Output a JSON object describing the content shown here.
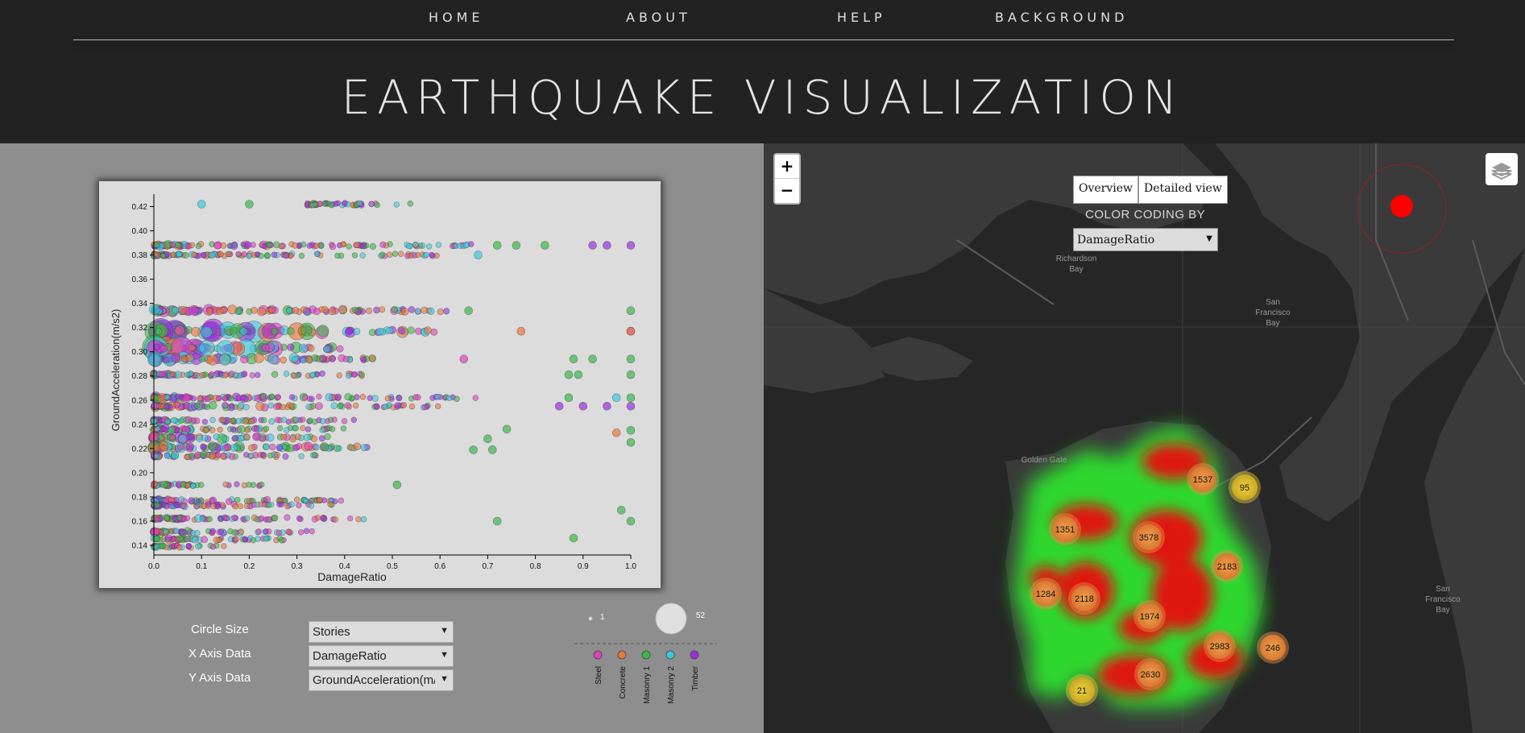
{
  "nav": {
    "home": "HOME",
    "about": "ABOUT",
    "help": "HELP",
    "background": "BACKGROUND"
  },
  "title": "EARTHQUAKE VISUALIZATION",
  "controls": {
    "circle_size_label": "Circle Size",
    "x_axis_label": "X Axis Data",
    "y_axis_label": "Y Axis Data",
    "circle_size_value": "Stories",
    "x_axis_value": "DamageRatio",
    "y_axis_value": "GroundAcceleration(m/s2)"
  },
  "size_legend": {
    "min": "1",
    "max": "52"
  },
  "type_legend": [
    {
      "name": "Steel",
      "color": "#e040c0"
    },
    {
      "name": "Concrete",
      "color": "#e8783a"
    },
    {
      "name": "Masonry 1",
      "color": "#3cb84a"
    },
    {
      "name": "Masonry 2",
      "color": "#3cc8e0"
    },
    {
      "name": "Timber",
      "color": "#9b30e0"
    }
  ],
  "chart_data": {
    "type": "scatter",
    "xlabel": "DamageRatio",
    "ylabel": "GroundAcceleration(m/s2)",
    "xlim": [
      0,
      1.0
    ],
    "ylim": [
      0.134,
      0.425
    ],
    "xticks": [
      "0.0",
      "0.1",
      "0.2",
      "0.3",
      "0.4",
      "0.5",
      "0.6",
      "0.7",
      "0.8",
      "0.9",
      "1.0"
    ],
    "yticks": [
      "0.14",
      "0.16",
      "0.18",
      "0.20",
      "0.22",
      "0.24",
      "0.26",
      "0.28",
      "0.30",
      "0.32",
      "0.34",
      "0.36",
      "0.38",
      "0.40",
      "0.42"
    ],
    "grid": false,
    "bands": [
      {
        "y": 0.422,
        "x": [
          0.32,
          0.55
        ],
        "sizes": [
          1,
          2
        ]
      },
      {
        "y": 0.388,
        "x": [
          0.0,
          0.68
        ],
        "sizes": [
          2,
          6
        ]
      },
      {
        "y": 0.38,
        "x": [
          0.0,
          0.62
        ],
        "sizes": [
          2,
          4
        ]
      },
      {
        "y": 0.334,
        "x": [
          0.0,
          0.62
        ],
        "sizes": [
          3,
          10
        ]
      },
      {
        "y": 0.317,
        "x": [
          0.0,
          0.6
        ],
        "sizes": [
          4,
          30
        ]
      },
      {
        "y": 0.303,
        "x": [
          0.0,
          0.4
        ],
        "sizes": [
          4,
          30
        ]
      },
      {
        "y": 0.294,
        "x": [
          0.0,
          0.48
        ],
        "sizes": [
          3,
          12
        ]
      },
      {
        "y": 0.281,
        "x": [
          0.0,
          0.46
        ],
        "sizes": [
          2,
          5
        ]
      },
      {
        "y": 0.262,
        "x": [
          0.0,
          0.68
        ],
        "sizes": [
          2,
          8
        ]
      },
      {
        "y": 0.255,
        "x": [
          0.0,
          0.6
        ],
        "sizes": [
          2,
          8
        ]
      },
      {
        "y": 0.243,
        "x": [
          0.0,
          0.42
        ],
        "sizes": [
          2,
          5
        ]
      },
      {
        "y": 0.236,
        "x": [
          0.0,
          0.4
        ],
        "sizes": [
          2,
          8
        ]
      },
      {
        "y": 0.229,
        "x": [
          0.0,
          0.38
        ],
        "sizes": [
          3,
          10
        ]
      },
      {
        "y": 0.221,
        "x": [
          0.0,
          0.48
        ],
        "sizes": [
          3,
          12
        ]
      },
      {
        "y": 0.214,
        "x": [
          0.0,
          0.35
        ],
        "sizes": [
          2,
          6
        ]
      },
      {
        "y": 0.19,
        "x": [
          0.0,
          0.23
        ],
        "sizes": [
          2,
          5
        ]
      },
      {
        "y": 0.177,
        "x": [
          0.0,
          0.4
        ],
        "sizes": [
          2,
          6
        ]
      },
      {
        "y": 0.173,
        "x": [
          0.0,
          0.38
        ],
        "sizes": [
          2,
          5
        ]
      },
      {
        "y": 0.162,
        "x": [
          0.0,
          0.45
        ],
        "sizes": [
          2,
          6
        ]
      },
      {
        "y": 0.151,
        "x": [
          0.0,
          0.35
        ],
        "sizes": [
          2,
          6
        ]
      },
      {
        "y": 0.145,
        "x": [
          0.0,
          0.28
        ],
        "sizes": [
          2,
          5
        ]
      },
      {
        "y": 0.139,
        "x": [
          0.0,
          0.15
        ],
        "sizes": [
          2,
          4
        ]
      }
    ],
    "outliers": [
      {
        "x": 0.1,
        "y": 0.422,
        "t": 3
      },
      {
        "x": 0.2,
        "y": 0.422,
        "t": 2
      },
      {
        "x": 0.72,
        "y": 0.388,
        "t": 2
      },
      {
        "x": 0.76,
        "y": 0.388,
        "t": 2
      },
      {
        "x": 0.82,
        "y": 0.388,
        "t": 2
      },
      {
        "x": 0.92,
        "y": 0.388,
        "t": 4
      },
      {
        "x": 0.95,
        "y": 0.388,
        "t": 4
      },
      {
        "x": 1.0,
        "y": 0.388,
        "t": 4
      },
      {
        "x": 0.68,
        "y": 0.38,
        "t": 3
      },
      {
        "x": 0.66,
        "y": 0.334,
        "t": 2
      },
      {
        "x": 1.0,
        "y": 0.334,
        "t": 2
      },
      {
        "x": 0.77,
        "y": 0.317,
        "t": 1
      },
      {
        "x": 1.0,
        "y": 0.317,
        "t": 0
      },
      {
        "x": 1.0,
        "y": 0.317,
        "t": 1
      },
      {
        "x": 0.65,
        "y": 0.294,
        "t": 0
      },
      {
        "x": 0.88,
        "y": 0.294,
        "t": 2
      },
      {
        "x": 0.92,
        "y": 0.294,
        "t": 2
      },
      {
        "x": 1.0,
        "y": 0.294,
        "t": 2
      },
      {
        "x": 0.87,
        "y": 0.281,
        "t": 2
      },
      {
        "x": 0.89,
        "y": 0.281,
        "t": 2
      },
      {
        "x": 1.0,
        "y": 0.281,
        "t": 2
      },
      {
        "x": 0.87,
        "y": 0.262,
        "t": 2
      },
      {
        "x": 0.97,
        "y": 0.262,
        "t": 3
      },
      {
        "x": 1.0,
        "y": 0.262,
        "t": 2
      },
      {
        "x": 0.85,
        "y": 0.255,
        "t": 4
      },
      {
        "x": 0.9,
        "y": 0.255,
        "t": 4
      },
      {
        "x": 0.95,
        "y": 0.255,
        "t": 4
      },
      {
        "x": 1.0,
        "y": 0.255,
        "t": 4
      },
      {
        "x": 0.74,
        "y": 0.236,
        "t": 2
      },
      {
        "x": 0.97,
        "y": 0.233,
        "t": 1
      },
      {
        "x": 1.0,
        "y": 0.235,
        "t": 2
      },
      {
        "x": 0.7,
        "y": 0.228,
        "t": 2
      },
      {
        "x": 1.0,
        "y": 0.225,
        "t": 2
      },
      {
        "x": 0.71,
        "y": 0.219,
        "t": 2
      },
      {
        "x": 0.67,
        "y": 0.219,
        "t": 2
      },
      {
        "x": 0.51,
        "y": 0.19,
        "t": 2
      },
      {
        "x": 0.98,
        "y": 0.169,
        "t": 2
      },
      {
        "x": 1.0,
        "y": 0.16,
        "t": 2
      },
      {
        "x": 0.72,
        "y": 0.16,
        "t": 2
      },
      {
        "x": 0.88,
        "y": 0.146,
        "t": 2
      }
    ]
  },
  "map": {
    "tabs": {
      "overview": "Overview",
      "detailed": "Detailed view"
    },
    "color_coding_label": "COLOR CODING BY",
    "color_coding_value": "DamageRatio",
    "place_labels": {
      "richardson": "Richardson\nBay",
      "sf_bay_1": "San\nFrancisco\nBay",
      "sf_bay_2": "San\nFrancisco\nBay",
      "golden_gate": "Golden Gate"
    },
    "clusters": [
      {
        "label": "1537",
        "tone": "orange"
      },
      {
        "label": "95",
        "tone": "yellow"
      },
      {
        "label": "1351",
        "tone": "orange"
      },
      {
        "label": "3578",
        "tone": "orange"
      },
      {
        "label": "2183",
        "tone": "orange"
      },
      {
        "label": "1284",
        "tone": "orange"
      },
      {
        "label": "2118",
        "tone": "orange"
      },
      {
        "label": "1974",
        "tone": "orange"
      },
      {
        "label": "2983",
        "tone": "orange"
      },
      {
        "label": "246",
        "tone": "orange"
      },
      {
        "label": "2630",
        "tone": "orange"
      },
      {
        "label": "21",
        "tone": "yellow"
      }
    ],
    "marker_color": "#ff0000"
  }
}
